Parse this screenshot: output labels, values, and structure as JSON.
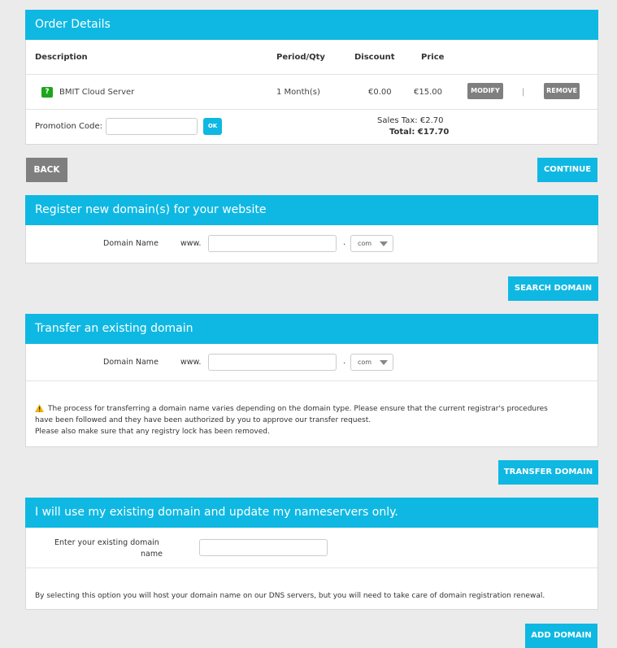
{
  "order": {
    "title": "Order Details",
    "columns": {
      "description": "Description",
      "period": "Period/Qty",
      "discount": "Discount",
      "price": "Price"
    },
    "item": {
      "badge": "?",
      "description": "BMIT Cloud Server",
      "period": "1 Month(s)",
      "discount": "€0.00",
      "price": "€15.00",
      "modify": "MODIFY",
      "separator": "|",
      "remove": "REMOVE"
    },
    "promo": {
      "label": "Promotion Code:",
      "value": "",
      "ok": "OK"
    },
    "sales_tax": "Sales Tax: €2.70",
    "total": "Total: €17.70"
  },
  "nav": {
    "back": "BACK",
    "continue": "CONTINUE"
  },
  "register": {
    "title": "Register new domain(s) for your website",
    "label": "Domain Name",
    "prefix": "www.",
    "dot": ".",
    "value": "",
    "tld": "com",
    "button": "SEARCH DOMAIN"
  },
  "transfer": {
    "title": "Transfer an existing domain",
    "label": "Domain Name",
    "prefix": "www.",
    "dot": ".",
    "value": "",
    "tld": "com",
    "note_line1": "The process for transferring a domain name varies depending on the domain type. Please ensure that the current registrar's procedures",
    "note_line2": "have been followed and they have been authorized by you to approve our transfer request.",
    "note_line3": "Please also make sure that any registry lock has been removed.",
    "button": "TRANSFER DOMAIN"
  },
  "existing": {
    "title": "I will use my existing domain and update my nameservers only.",
    "label_line1": "Enter your existing domain",
    "label_line2": "name",
    "value": "",
    "note": "By selecting this option you will host your domain name on our DNS servers, but you will need to take care of domain registration renewal.",
    "button": "ADD DOMAIN"
  },
  "colors": {
    "accent": "#0fb8e2",
    "grey_button": "#7f7f7f",
    "badge_green": "#1ea51e",
    "warning": "#f0b400"
  }
}
